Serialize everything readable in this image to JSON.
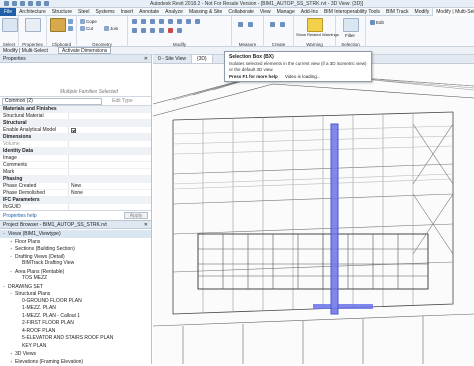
{
  "window": {
    "title": "Autodesk Revit 2018.2 - Not For Resale Version - [BIM1_AUTOP_SS_STRK.rvt - 3D View: {3D}]"
  },
  "tabs": [
    "File",
    "Architecture",
    "Structure",
    "Steel",
    "Systems",
    "Insert",
    "Annotate",
    "Analyze",
    "Massing & Site",
    "Collaborate",
    "View",
    "Manage",
    "Add-Ins",
    "BIM Interoperability Tools",
    "BIM Track",
    "Modify",
    "Modify | Multi-Select"
  ],
  "ribbon": {
    "groups": {
      "select": "Select",
      "properties": "Properties",
      "clipboard": "Clipboard",
      "geometry": "Geometry",
      "modify": "Modify",
      "measure": "Measure",
      "create": "Create",
      "warning": "Warning",
      "selection": "Selection"
    },
    "cope": "Cope",
    "cut": "Cut",
    "join": "Join",
    "show_related": "Show Related Warnings",
    "filter": "Filter",
    "edit": "Edit"
  },
  "optbar": {
    "mode": "Modify | Multi-Select",
    "active_dimensions": "Activate Dimensions"
  },
  "properties": {
    "title": "Properties",
    "placeholder": "Multiple Families Selected",
    "filter": "Common (2)",
    "edit_type": "Edit Type",
    "rows": [
      {
        "k": "Materials and Finishes",
        "v": "",
        "cat": true
      },
      {
        "k": "Structural Material",
        "v": ""
      },
      {
        "k": "Structural",
        "v": "",
        "cat": true
      },
      {
        "k": "Enable Analytical Model",
        "v": "check"
      },
      {
        "k": "Dimensions",
        "v": "",
        "cat": true
      },
      {
        "k": "Volume",
        "v": "",
        "dim": true
      },
      {
        "k": "Identity Data",
        "v": "",
        "cat": true
      },
      {
        "k": "Image",
        "v": ""
      },
      {
        "k": "Comments",
        "v": ""
      },
      {
        "k": "Mark",
        "v": ""
      },
      {
        "k": "Phasing",
        "v": "",
        "cat": true
      },
      {
        "k": "Phase Created",
        "v": "New"
      },
      {
        "k": "Phase Demolished",
        "v": "None"
      },
      {
        "k": "IFC Parameters",
        "v": "",
        "cat": true
      },
      {
        "k": "IfcGUID",
        "v": ""
      }
    ],
    "help": "Properties help",
    "apply": "Apply"
  },
  "browser": {
    "title": "Project Browser - BIM1_AUTOP_SS_STRK.rvt",
    "nodes": [
      {
        "t": "Views (BIM1_Viewtype)",
        "d": 0,
        "tg": "−",
        "sel": true
      },
      {
        "t": "Floor Plans",
        "d": 1,
        "tg": "+"
      },
      {
        "t": "Sections (Building Section)",
        "d": 1,
        "tg": "+"
      },
      {
        "t": "Drafting Views (Detail)",
        "d": 1,
        "tg": "−"
      },
      {
        "t": "BIMTrack Drafting View",
        "d": 2,
        "tg": ""
      },
      {
        "t": "Area Plans (Rentable)",
        "d": 1,
        "tg": "−"
      },
      {
        "t": "TOS MEZZ",
        "d": 2,
        "tg": ""
      },
      {
        "t": "DRAWING SET",
        "d": 0,
        "tg": "−"
      },
      {
        "t": "Structural Plans",
        "d": 1,
        "tg": "−"
      },
      {
        "t": "0-GROUND FLOOR PLAN",
        "d": 2,
        "tg": ""
      },
      {
        "t": "1-MEZZ. PLAN",
        "d": 2,
        "tg": ""
      },
      {
        "t": "1-MEZZ. PLAN - Callout 1",
        "d": 2,
        "tg": ""
      },
      {
        "t": "2-FIRST FLOOR PLAN",
        "d": 2,
        "tg": ""
      },
      {
        "t": "4-ROOF PLAN",
        "d": 2,
        "tg": ""
      },
      {
        "t": "5-ELEVATOR AND STAIRS ROOF PLAN",
        "d": 2,
        "tg": ""
      },
      {
        "t": "KEY PLAN",
        "d": 2,
        "tg": ""
      },
      {
        "t": "3D Views",
        "d": 1,
        "tg": "+"
      },
      {
        "t": "Elevations (Framing Elevation)",
        "d": 1,
        "tg": "+"
      }
    ]
  },
  "viewtabs": [
    "0 - Site View",
    "{3D}"
  ],
  "tooltip": {
    "title": "Selection Box (BX)",
    "description": "Isolates selected elements in the current view (if a 3D isometric view) or the default 3D view.",
    "f1": "Press F1 for more help",
    "video": "Video is loading..."
  },
  "colors": {
    "accent": "#1f5fa8",
    "selection_blue": "#6a74e8"
  }
}
